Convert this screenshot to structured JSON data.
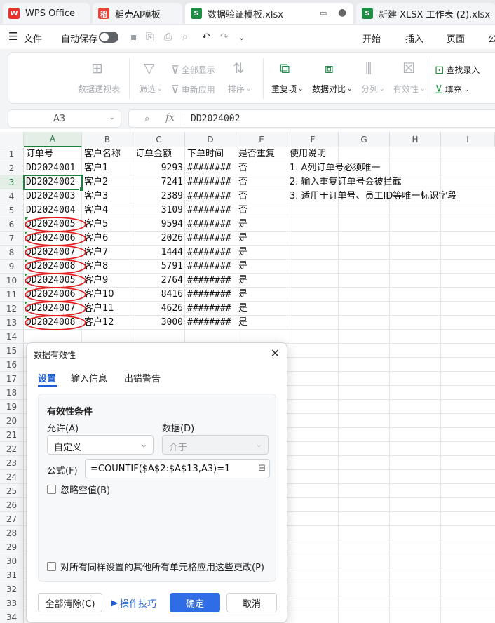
{
  "tabs": [
    {
      "label": "WPS Office",
      "icon": "W"
    },
    {
      "label": "稻壳AI模板",
      "icon": "稻"
    },
    {
      "label": "数据验证模板.xlsx",
      "icon": "S"
    },
    {
      "label": "新建 XLSX 工作表 (2).xlsx",
      "icon": "S"
    }
  ],
  "menubar": {
    "file": "文件",
    "autosave": "自动保存",
    "items": [
      "开始",
      "插入",
      "页面",
      "公"
    ]
  },
  "ribbon": {
    "pivot": "数据透视表",
    "filter": "筛选",
    "show_all": "全部显示",
    "reapply": "重新应用",
    "sort": "排序",
    "duplicates": "重复项",
    "compare": "数据对比",
    "split": "分列",
    "validity": "有效性",
    "lookup": "查找录入",
    "fill": "填充"
  },
  "formula_bar": {
    "cell_ref": "A3",
    "fx": "fx",
    "value": "DD2024002"
  },
  "columns": [
    "A",
    "B",
    "C",
    "D",
    "E",
    "F",
    "G",
    "H",
    "I"
  ],
  "rows": [
    "1",
    "2",
    "3",
    "4",
    "5",
    "6",
    "7",
    "8",
    "9",
    "10",
    "11",
    "12",
    "13",
    "14",
    "15",
    "16",
    "17",
    "18",
    "19",
    "20",
    "21",
    "22",
    "23",
    "24",
    "25",
    "26",
    "27",
    "28",
    "29",
    "30",
    "31",
    "32",
    "33",
    "34"
  ],
  "sheet": {
    "headers": [
      "订单号",
      "客户名称",
      "订单金额",
      "下单时间",
      "是否重复",
      "使用说明"
    ],
    "data": [
      [
        "DD2024001",
        "客户1",
        "9293",
        "########",
        "否"
      ],
      [
        "DD2024002",
        "客户2",
        "7241",
        "########",
        "否"
      ],
      [
        "DD2024003",
        "客户3",
        "2389",
        "########",
        "否"
      ],
      [
        "DD2024004",
        "客户4",
        "3109",
        "########",
        "否"
      ],
      [
        "DD2024005",
        "客户5",
        "9594",
        "########",
        "是"
      ],
      [
        "DD2024006",
        "客户6",
        "2026",
        "########",
        "是"
      ],
      [
        "DD2024007",
        "客户7",
        "1444",
        "########",
        "是"
      ],
      [
        "DD2024008",
        "客户8",
        "5791",
        "########",
        "是"
      ],
      [
        "DD2024005",
        "客户9",
        "2764",
        "########",
        "是"
      ],
      [
        "DD2024006",
        "客户10",
        "8416",
        "########",
        "是"
      ],
      [
        "DD2024007",
        "客户11",
        "4626",
        "########",
        "是"
      ],
      [
        "DD2024008",
        "客户12",
        "3000",
        "########",
        "是"
      ]
    ],
    "notes": [
      "1. A列订单号必须唯一",
      "2. 输入重复订单号会被拦截",
      "3. 适用于订单号、员工ID等唯一标识字段"
    ]
  },
  "dialog": {
    "title": "数据有效性",
    "tabs": [
      "设置",
      "输入信息",
      "出错警告"
    ],
    "section_title": "有效性条件",
    "allow_label": "允许(A)",
    "allow_value": "自定义",
    "data_label": "数据(D)",
    "data_value": "介于",
    "formula_label": "公式(F)",
    "formula_value": "=COUNTIF($A$2:$A$13,A3)=1",
    "ignore_blank": "忽略空值(B)",
    "apply_all": "对所有同样设置的其他所有单元格应用这些更改(P)",
    "clear_all": "全部清除(C)",
    "tips": "操作技巧",
    "ok": "确定",
    "cancel": "取消"
  }
}
